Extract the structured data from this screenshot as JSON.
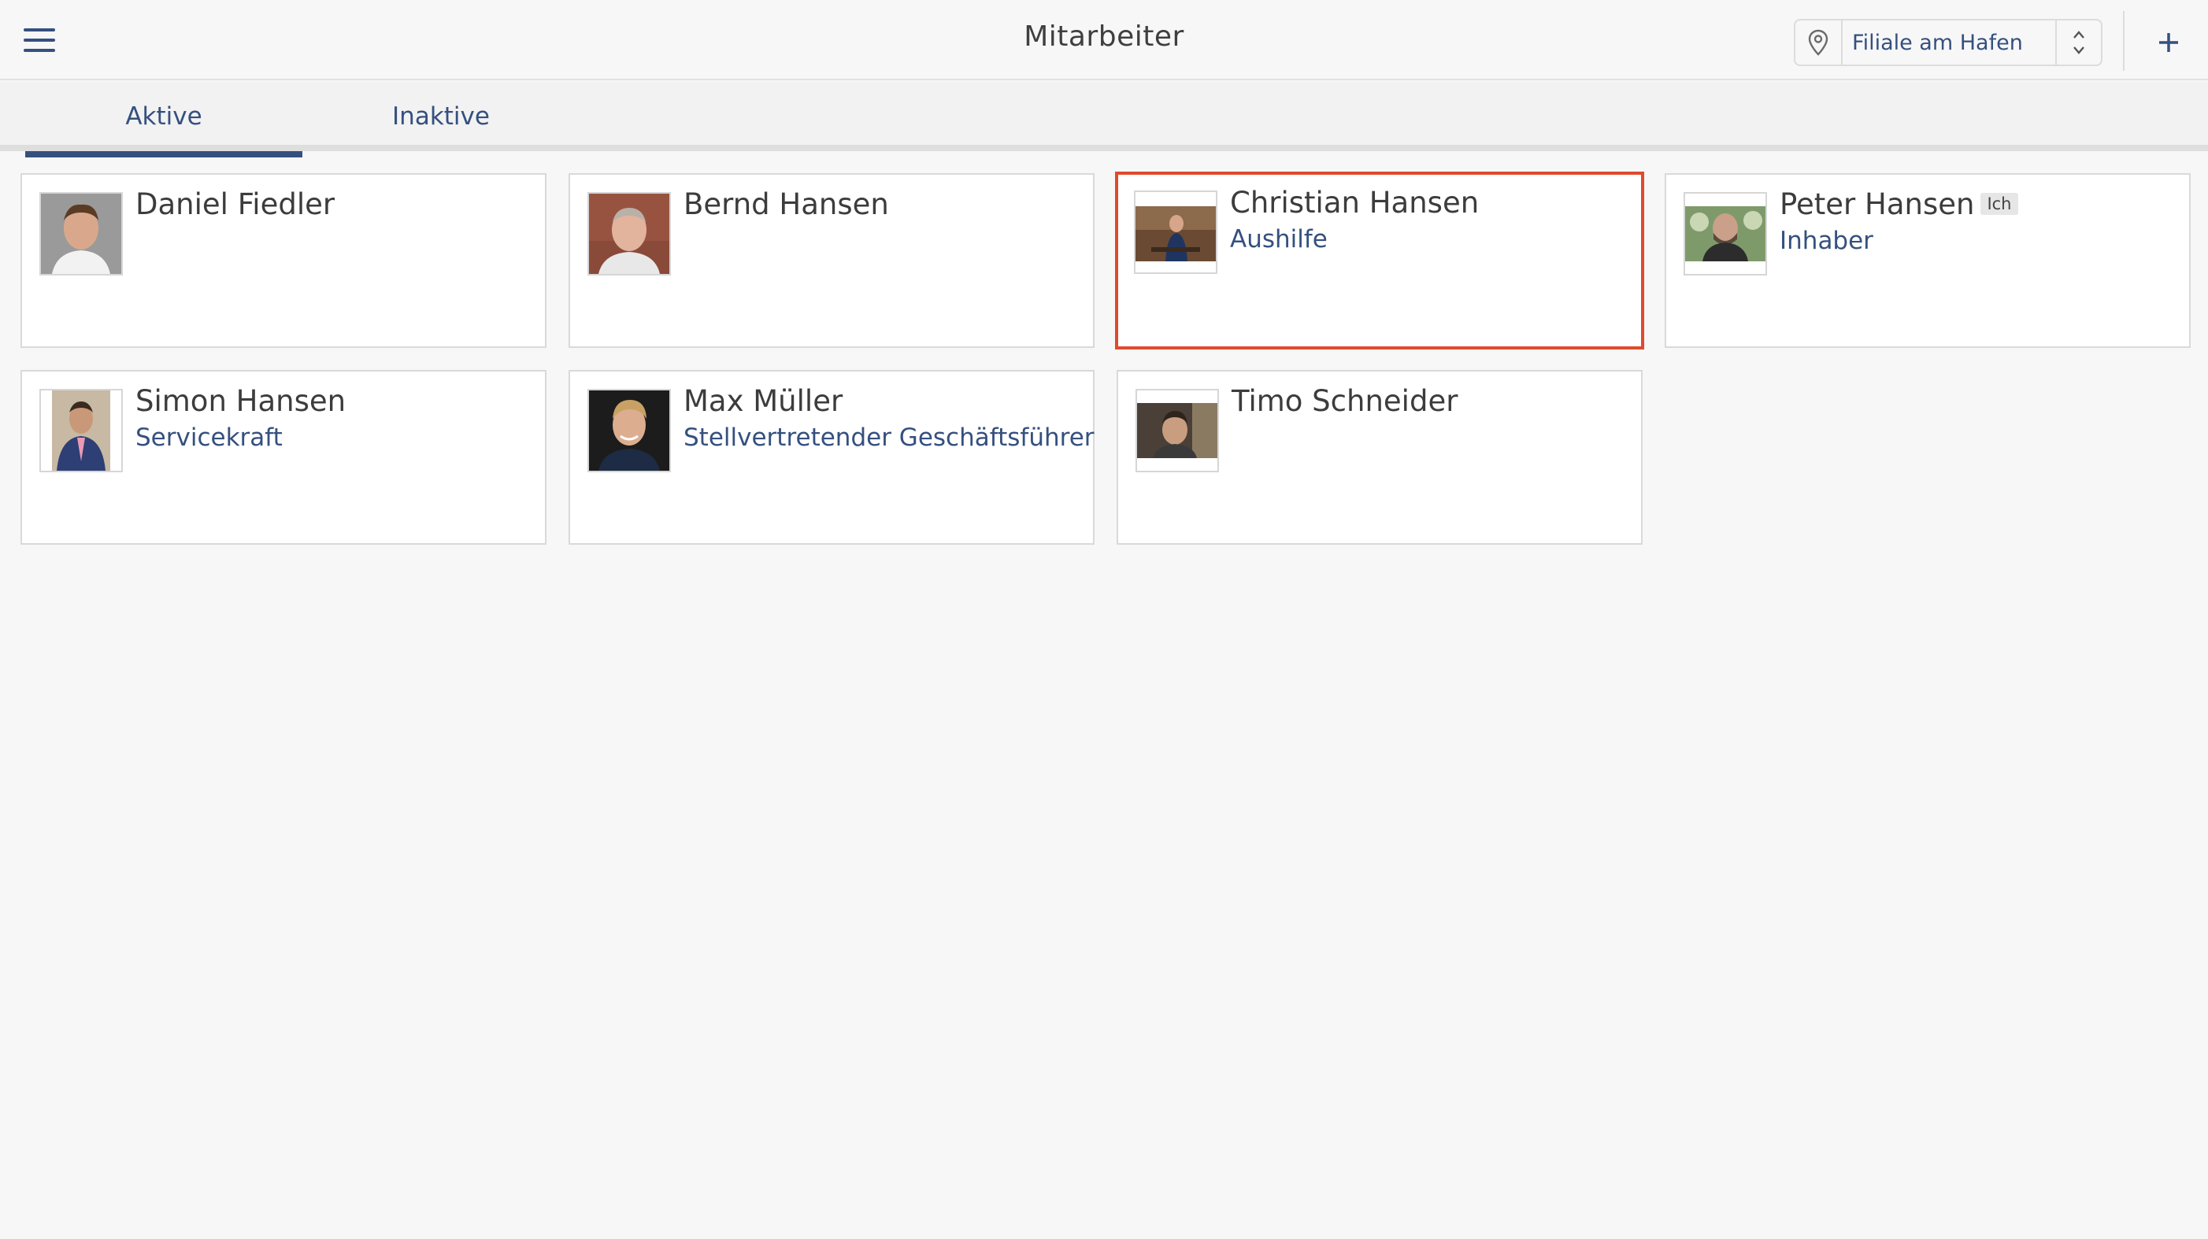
{
  "header": {
    "title": "Mitarbeiter",
    "location": "Filiale am Hafen",
    "icons": {
      "menu": "hamburger-menu-icon",
      "location": "map-pin-icon",
      "spinner": "up-down-chevron-icon",
      "add": "plus-icon"
    }
  },
  "tabs": [
    {
      "label": "Aktive",
      "active": true
    },
    {
      "label": "Inaktive",
      "active": false
    }
  ],
  "employees": [
    {
      "name": "Daniel Fiedler",
      "role": "",
      "photo": "portrait-photo",
      "selected": false
    },
    {
      "name": "Bernd Hansen",
      "role": "",
      "photo": "portrait-photo",
      "selected": false
    },
    {
      "name": "Christian Hansen",
      "role": "Aushilfe",
      "photo": "portrait-photo",
      "selected": true
    },
    {
      "name": "Peter Hansen",
      "role": "Inhaber",
      "badge": "Ich",
      "photo": "portrait-photo",
      "selected": false
    },
    {
      "name": "Simon Hansen",
      "role": "Servicekraft",
      "photo": "portrait-photo",
      "selected": false
    },
    {
      "name": "Max Müller",
      "role": "Stellvertretender Geschäftsführer",
      "photo": "portrait-photo",
      "selected": false
    },
    {
      "name": "Timo Schneider",
      "role": "",
      "photo": "portrait-photo",
      "selected": false
    }
  ],
  "colors": {
    "accent": "#35507f",
    "selected_border": "#df4a2d",
    "background": "#f7f7f7"
  }
}
